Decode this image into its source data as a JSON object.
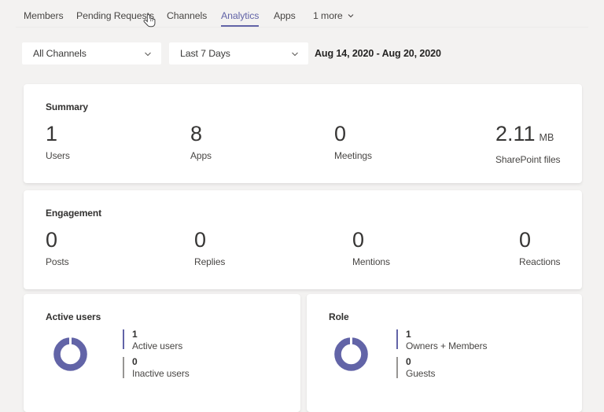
{
  "colors": {
    "accent": "#6264a7",
    "inactive_gray": "#979593",
    "page_bg": "#f3f2f1",
    "card_bg": "#ffffff"
  },
  "tabs": {
    "items": [
      {
        "label": "Members"
      },
      {
        "label": "Pending Requests"
      },
      {
        "label": "Channels"
      },
      {
        "label": "Analytics"
      },
      {
        "label": "Apps"
      }
    ],
    "active_tab": "Analytics",
    "more_label": "1 more"
  },
  "filters": {
    "channel_select": "All Channels",
    "period_select": "Last 7 Days",
    "date_range": "Aug 14, 2020 - Aug 20, 2020"
  },
  "summary": {
    "title": "Summary",
    "stats": [
      {
        "value": "1",
        "label": "Users"
      },
      {
        "value": "8",
        "label": "Apps"
      },
      {
        "value": "0",
        "label": "Meetings"
      },
      {
        "value": "2.11",
        "unit": "MB",
        "label": "SharePoint files"
      }
    ]
  },
  "engagement": {
    "title": "Engagement",
    "stats": [
      {
        "value": "0",
        "label": "Posts"
      },
      {
        "value": "0",
        "label": "Replies"
      },
      {
        "value": "0",
        "label": "Mentions"
      },
      {
        "value": "0",
        "label": "Reactions"
      }
    ]
  },
  "charts": [
    {
      "title": "Active users",
      "type": "donut",
      "segments": [
        {
          "value": "1",
          "label": "Active users",
          "color": "#6264a7"
        },
        {
          "value": "0",
          "label": "Inactive users",
          "color": "#979593"
        }
      ]
    },
    {
      "title": "Role",
      "type": "donut",
      "segments": [
        {
          "value": "1",
          "label": "Owners + Members",
          "color": "#6264a7"
        },
        {
          "value": "0",
          "label": "Guests",
          "color": "#979593"
        }
      ]
    }
  ]
}
